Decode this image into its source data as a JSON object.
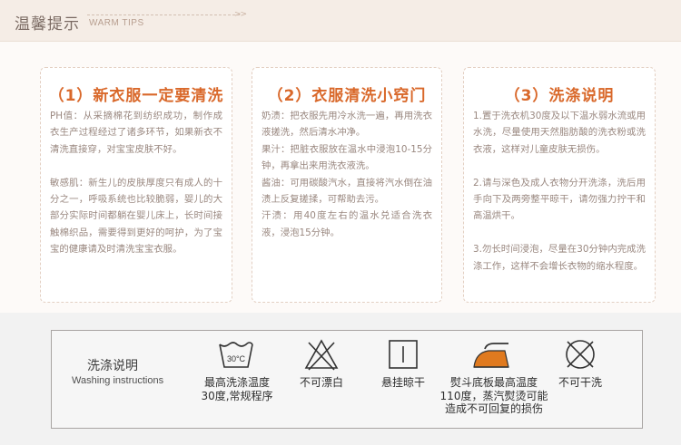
{
  "header": {
    "title": "温馨提示",
    "subtitle": "WARM TIPS",
    "arrows": ">>"
  },
  "cards": [
    {
      "title": "（1）新衣服一定要清洗",
      "paragraphs": [
        "PH值：从采摘棉花到纺织成功，制作成衣生产过程经过了诸多环节，如果新衣不清洗直接穿，对宝宝皮肤不好。",
        "敏感肌：新生儿的皮肤厚度只有成人的十分之一，呼吸系统也比较脆弱，婴儿的大部分实际时间都躺在婴儿床上，长时间接触棉织品，需要得到更好的呵护，为了宝宝的健康请及时清洗宝宝衣服。"
      ]
    },
    {
      "title": "（2）衣服清洗小窍门",
      "paragraphs": [
        "奶渍：把衣服先用冷水洗一遍，再用洗衣液搓洗，然后清水冲净。",
        "果汁：把脏衣服放在温水中浸泡10-15分钟，再拿出来用洗衣液洗。",
        "酱油：可用碳酸汽水，直接将汽水倒在油渍上反复搓揉，可帮助去污。",
        "汗渍：用40度左右的温水兑适合洗衣液，浸泡15分钟。"
      ]
    },
    {
      "title": "（3）洗涤说明",
      "paragraphs": [
        "1.置于洗衣机30度及以下温水弱水流或用水洗，尽量使用天然脂肪酸的洗衣粉或洗衣液，这样对儿童皮肤无损伤。",
        "2.请与深色及成人衣物分开洗涤，洗后用手向下及两旁整平晾干，请勿强力拧干和高温烘干。",
        "3.勿长时间浸泡，尽量在30分钟内完成洗涤工作，这样不会增长衣物的缩水程度。"
      ]
    }
  ],
  "washing": {
    "title": "洗涤说明",
    "subtitle": "Washing instructions",
    "items": [
      {
        "icon": "wash-30-icon",
        "symbol_text": "30°C",
        "label": "最高洗涤温度\n30度,常规程序"
      },
      {
        "icon": "no-bleach-icon",
        "label": "不可漂白"
      },
      {
        "icon": "hang-dry-icon",
        "label": "悬挂晾干"
      },
      {
        "icon": "iron-110-icon",
        "label": "熨斗底板最高温度\n110度，蒸汽熨烫可能\n造成不可回复的损伤"
      },
      {
        "icon": "no-dry-clean-icon",
        "label": "不可干洗"
      }
    ]
  },
  "colors": {
    "accent": "#d9682a",
    "body_text": "#9a8880",
    "banner_bg": "#f5ede6",
    "card_border": "#e3cfc2"
  }
}
